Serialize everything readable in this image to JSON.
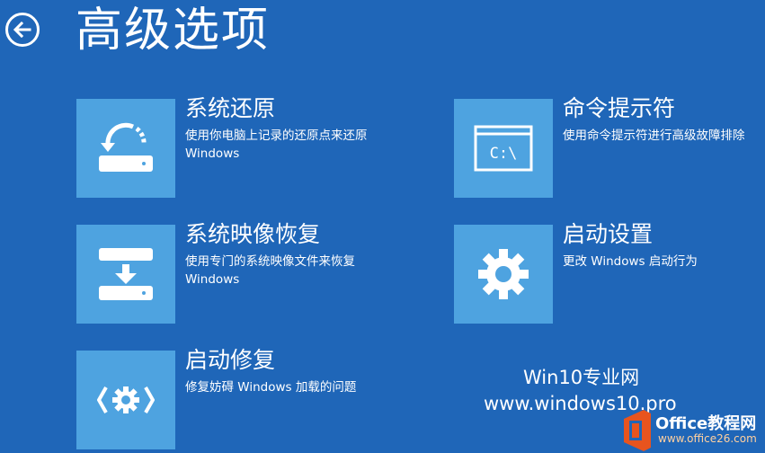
{
  "header": {
    "title": "高级选项",
    "back_icon": "back-arrow-icon"
  },
  "options": [
    {
      "title": "系统还原",
      "description": "使用你电脑上记录的还原点来还原\nWindows",
      "icon": "system-restore-icon"
    },
    {
      "title": "系统映像恢复",
      "description": "使用专门的系统映像文件来恢复\nWindows",
      "icon": "system-image-icon"
    },
    {
      "title": "启动修复",
      "description": "修复妨碍 Windows 加载的问题",
      "icon": "startup-repair-icon"
    },
    {
      "title": "命令提示符",
      "description": "使用命令提示符进行高级故障排除",
      "icon": "command-prompt-icon",
      "icon_text": "C:\\"
    },
    {
      "title": "启动设置",
      "description": "更改 Windows 启动行为",
      "icon": "gear-icon"
    }
  ],
  "watermark": {
    "line1": "Win10专业网",
    "line2": "www.windows10.pro",
    "brand": "Office教程网",
    "brand_url": "www.office26.com"
  },
  "colors": {
    "background": "#1f66b8",
    "tile": "#4ea3e0",
    "office_orange": "#e8541e"
  }
}
